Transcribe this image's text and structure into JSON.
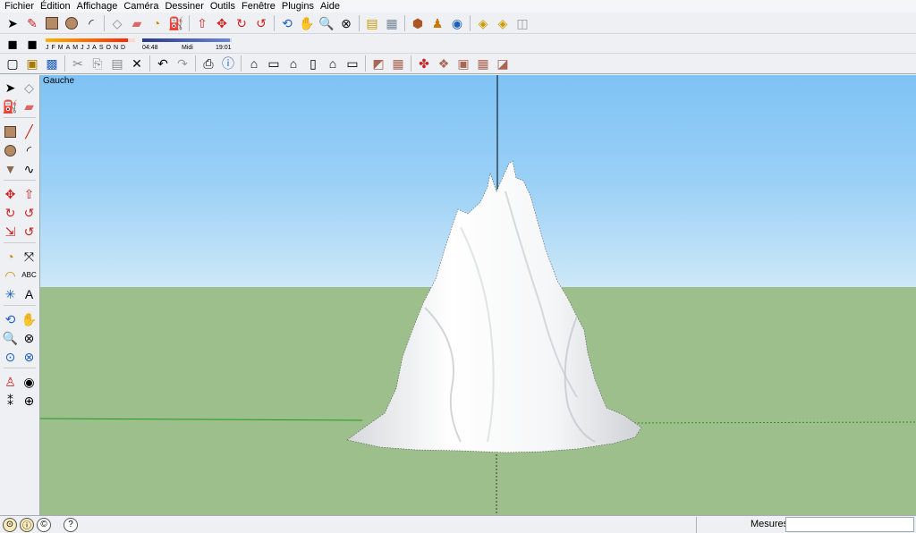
{
  "menu": [
    "Fichier",
    "Édition",
    "Affichage",
    "Caméra",
    "Dessiner",
    "Outils",
    "Fenêtre",
    "Plugins",
    "Aide"
  ],
  "viewport": {
    "view_label": "Gauche"
  },
  "shadow": {
    "months": [
      "J",
      "F",
      "M",
      "A",
      "M",
      "J",
      "J",
      "A",
      "S",
      "O",
      "N",
      "D"
    ],
    "date_fill": 0.92,
    "time_start": "04:48",
    "time_mid": "Midi",
    "time_end": "19:01",
    "time_fill": 0.98
  },
  "status": {
    "measure_label": "Mesures",
    "measure_value": ""
  },
  "colors": {
    "sky_top": "#7ec3f5",
    "ground": "#9cbf8b",
    "accent_red": "#d8261d",
    "accent_blue": "#1f5fbf"
  },
  "toolbar1_icons": [
    "select-icon",
    "pencil-icon",
    "rectangle-icon",
    "circle-icon",
    "arc-icon",
    "make-component-icon",
    "eraser-icon",
    "tape-measure-icon",
    "paint-bucket-icon",
    "push-pull-icon",
    "move-icon",
    "rotate-icon",
    "follow-me-icon",
    "orbit-icon",
    "pan-icon",
    "zoom-icon",
    "zoom-extents-icon",
    "get-models-icon",
    "share-model-icon",
    "components-icon",
    "google-earth-icon",
    "toposhaper-icon",
    "import-icon",
    "export-icon"
  ],
  "toolbar3_icons": [
    "new-icon",
    "open-icon",
    "save-icon",
    "cut-icon",
    "copy-icon",
    "paste-icon",
    "delete-icon",
    "undo-icon",
    "redo-icon",
    "print-icon",
    "model-info-icon",
    "iso-view-icon",
    "top-view-icon",
    "front-view-icon",
    "right-view-icon",
    "back-view-icon",
    "left-view-icon",
    "sandbox-from-contours-icon",
    "sandbox-from-scratch-icon",
    "smoove-icon",
    "stamp-icon",
    "drape-icon",
    "add-detail-icon",
    "flip-edge-icon"
  ]
}
